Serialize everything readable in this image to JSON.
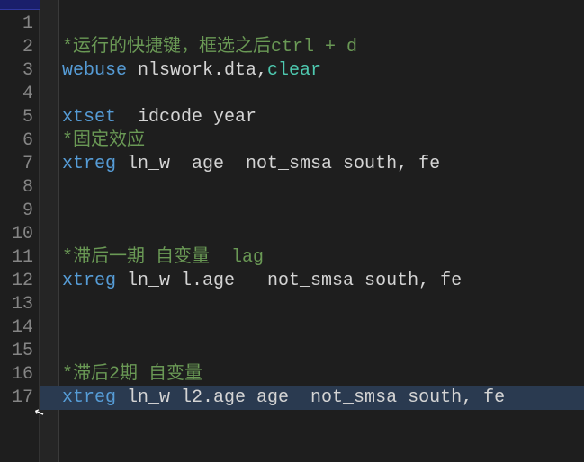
{
  "editor": {
    "tab_active": true,
    "lines": [
      {
        "num": 1,
        "tokens": []
      },
      {
        "num": 2,
        "tokens": [
          {
            "cls": "tok-comment",
            "t": "*运行的快捷键，框选之后ctrl + d"
          }
        ]
      },
      {
        "num": 3,
        "tokens": [
          {
            "cls": "tok-cmd",
            "t": "webuse"
          },
          {
            "cls": "tok-plain",
            "t": " nlswork.dta,"
          },
          {
            "cls": "tok-option",
            "t": "clear"
          }
        ]
      },
      {
        "num": 4,
        "tokens": []
      },
      {
        "num": 5,
        "tokens": [
          {
            "cls": "tok-cmd",
            "t": "xtset"
          },
          {
            "cls": "tok-plain",
            "t": "  idcode year"
          }
        ]
      },
      {
        "num": 6,
        "tokens": [
          {
            "cls": "tok-comment",
            "t": "*固定效应"
          }
        ]
      },
      {
        "num": 7,
        "tokens": [
          {
            "cls": "tok-cmd",
            "t": "xtreg"
          },
          {
            "cls": "tok-plain",
            "t": " ln_w  age  not_smsa south, fe"
          }
        ]
      },
      {
        "num": 8,
        "tokens": []
      },
      {
        "num": 9,
        "tokens": []
      },
      {
        "num": 10,
        "tokens": []
      },
      {
        "num": 11,
        "tokens": [
          {
            "cls": "tok-comment",
            "t": "*滞后一期 自变量  lag"
          }
        ]
      },
      {
        "num": 12,
        "tokens": [
          {
            "cls": "tok-cmd",
            "t": "xtreg"
          },
          {
            "cls": "tok-plain",
            "t": " ln_w l.age   not_smsa south, fe"
          }
        ]
      },
      {
        "num": 13,
        "tokens": []
      },
      {
        "num": 14,
        "tokens": []
      },
      {
        "num": 15,
        "tokens": []
      },
      {
        "num": 16,
        "tokens": [
          {
            "cls": "tok-comment",
            "t": "*滞后2期 自变量"
          }
        ]
      },
      {
        "num": 17,
        "highlight": true,
        "tokens": [
          {
            "cls": "tok-cmd",
            "t": "xtreg"
          },
          {
            "cls": "tok-plain",
            "t": " ln_w l2.age age  not_smsa south, fe"
          }
        ]
      }
    ],
    "cursor_glyph": "↖"
  }
}
